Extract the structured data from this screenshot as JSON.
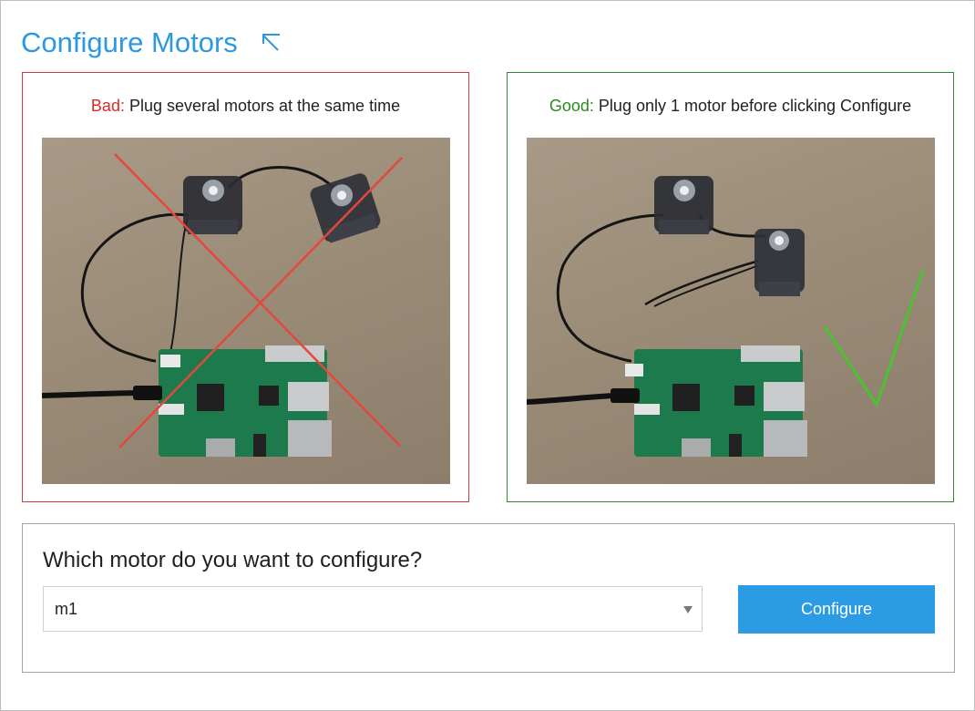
{
  "header": {
    "title": "Configure Motors",
    "collapse_icon": "collapse-arrow-icon"
  },
  "bad_panel": {
    "prefix": "Bad:",
    "text": " Plug several motors at the same time",
    "accent_color": "#e02727",
    "image": "photo-two-motors-plugged-crossed-out"
  },
  "good_panel": {
    "prefix": "Good:",
    "text": " Plug only 1 motor before clicking Configure",
    "accent_color": "#2a8a1e",
    "image": "photo-one-motor-plugged-checkmark"
  },
  "form": {
    "question": "Which motor do you want to configure?",
    "selected_motor": "m1",
    "configure_label": "Configure",
    "button_color": "#2b9be4"
  }
}
